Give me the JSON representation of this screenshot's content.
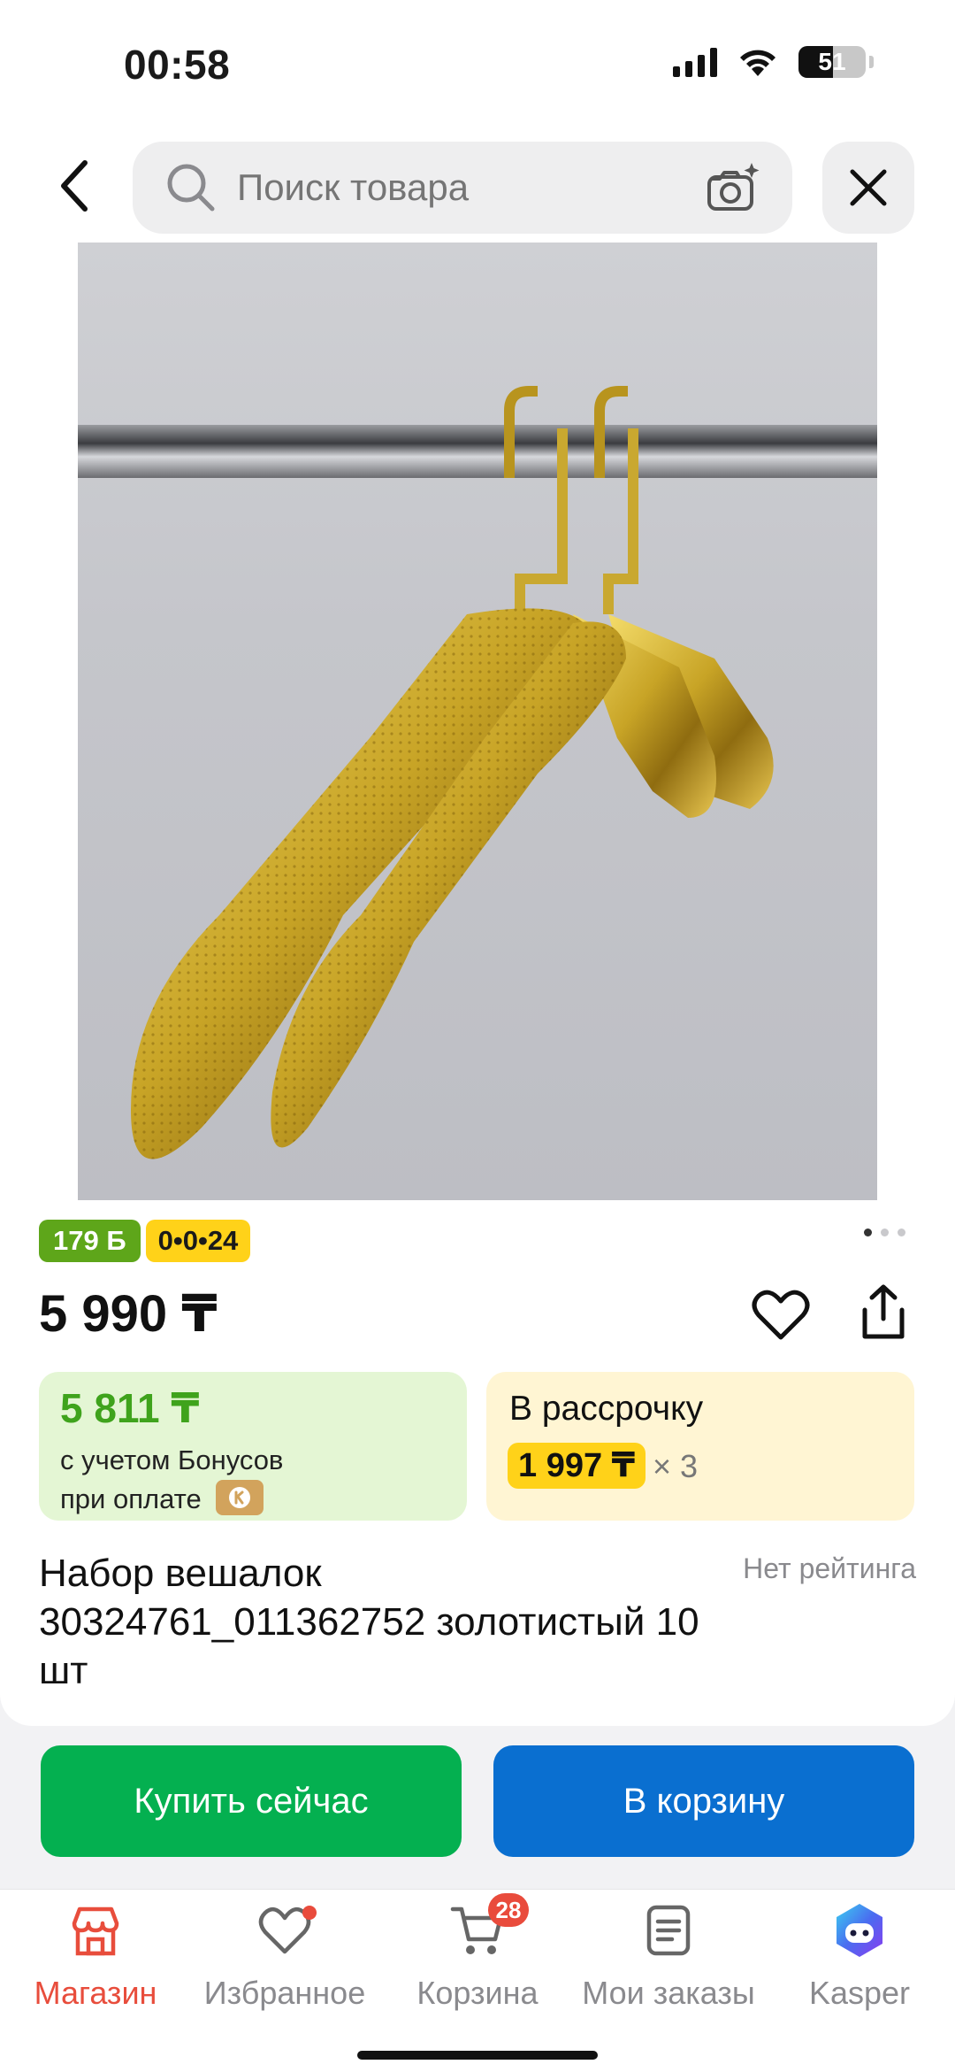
{
  "status": {
    "time": "00:58",
    "battery": "51",
    "battery_level": 0.51
  },
  "search": {
    "placeholder": "Поиск товара"
  },
  "badges": {
    "bonus": "179 Б",
    "installment": "0•0•24"
  },
  "gallery": {
    "pages": 3,
    "active": 1
  },
  "product": {
    "price": "5 990 ₸",
    "title": "Набор вешалок 30324761_011362752 золотистый 10 шт",
    "rating_text": "Нет рейтинга"
  },
  "bonus_card": {
    "price": "5 811 ₸",
    "line1": "с учетом Бонусов",
    "line2": "при оплате"
  },
  "installment_card": {
    "title": "В рассрочку",
    "amount": "1 997 ₸",
    "multiplier": "× 3"
  },
  "actions": {
    "buy_now": "Купить сейчас",
    "add_to_cart": "В корзину"
  },
  "tabbar": {
    "items": [
      {
        "label": "Магазин",
        "icon": "shop-icon"
      },
      {
        "label": "Избранное",
        "icon": "heart-icon"
      },
      {
        "label": "Корзина",
        "icon": "cart-icon",
        "badge": "28"
      },
      {
        "label": "Мои заказы",
        "icon": "orders-icon"
      },
      {
        "label": "Kasper",
        "icon": "kasper-icon"
      }
    ]
  },
  "colors": {
    "accent_red": "#e84d3c",
    "buy_green": "#04b050",
    "cart_blue": "#0a6fd0",
    "bonus_green": "#3fa31c",
    "yellow": "#ffd219"
  }
}
